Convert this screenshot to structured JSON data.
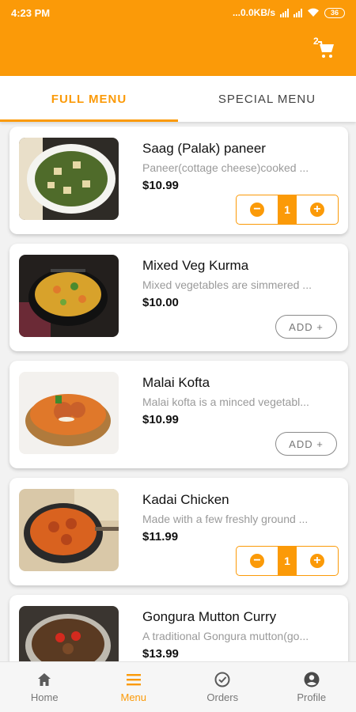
{
  "status": {
    "time": "4:23 PM",
    "net_speed": "...0.0KB/s",
    "battery": "36"
  },
  "header": {
    "cart_count": "2",
    "cart_icon": "shopping-cart-icon"
  },
  "tabs": [
    {
      "label": "FULL MENU",
      "active": true
    },
    {
      "label": "SPECIAL MENU",
      "active": false
    }
  ],
  "colors": {
    "accent": "#fb9a08"
  },
  "menu_items": [
    {
      "name": "Saag (Palak) paneer",
      "description": "Paneer(cottage cheese)cooked ...",
      "price": "$10.99",
      "control": "stepper",
      "quantity": "1"
    },
    {
      "name": "Mixed Veg Kurma",
      "description": "Mixed vegetables are simmered ...",
      "price": "$10.00",
      "control": "add",
      "add_label": "ADD +"
    },
    {
      "name": "Malai Kofta",
      "description": "Malai kofta is a minced vegetabl...",
      "price": "$10.99",
      "control": "add",
      "add_label": "ADD +"
    },
    {
      "name": "Kadai Chicken",
      "description": "Made with a few freshly ground ...",
      "price": "$11.99",
      "control": "stepper",
      "quantity": "1"
    },
    {
      "name": "Gongura Mutton Curry",
      "description": "A traditional Gongura mutton(go...",
      "price": "$13.99",
      "control": "none"
    }
  ],
  "stepper": {
    "minus": "−",
    "plus": "+"
  },
  "bottom_nav": [
    {
      "label": "Home",
      "icon": "home-icon",
      "active": false
    },
    {
      "label": "Menu",
      "icon": "menu-icon",
      "active": true
    },
    {
      "label": "Orders",
      "icon": "orders-check-icon",
      "active": false
    },
    {
      "label": "Profile",
      "icon": "profile-icon",
      "active": false
    }
  ]
}
